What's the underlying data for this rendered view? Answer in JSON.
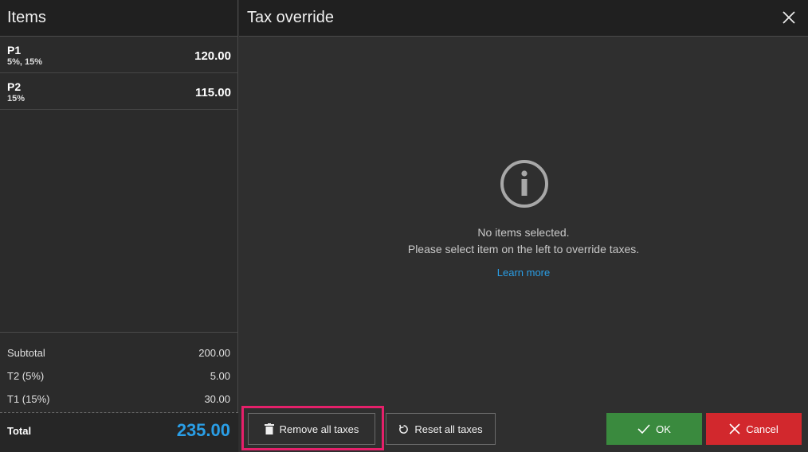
{
  "items_panel": {
    "title": "Items",
    "items": [
      {
        "name": "P1",
        "taxes": "5%, 15%",
        "price": "120.00"
      },
      {
        "name": "P2",
        "taxes": "15%",
        "price": "115.00"
      }
    ],
    "summary": [
      {
        "label": "Subtotal",
        "value": "200.00"
      },
      {
        "label": "T2 (5%)",
        "value": "5.00"
      },
      {
        "label": "T1 (15%)",
        "value": "30.00"
      }
    ],
    "total_label": "Total",
    "total_value": "235.00"
  },
  "dialog": {
    "title": "Tax override",
    "empty_line1": "No items selected.",
    "empty_line2": "Please select item on the left to override taxes.",
    "learn_more": "Learn more",
    "remove_all_label": "Remove all taxes",
    "reset_all_label": "Reset all taxes",
    "ok_label": "OK",
    "cancel_label": "Cancel"
  },
  "colors": {
    "accent": "#2a9ee6",
    "ok": "#3a8a3e",
    "cancel": "#d2282d",
    "highlight": "#e5206a"
  },
  "icons": [
    "close-icon",
    "info-icon",
    "trash-icon",
    "reset-icon",
    "check-icon",
    "x-icon"
  ]
}
